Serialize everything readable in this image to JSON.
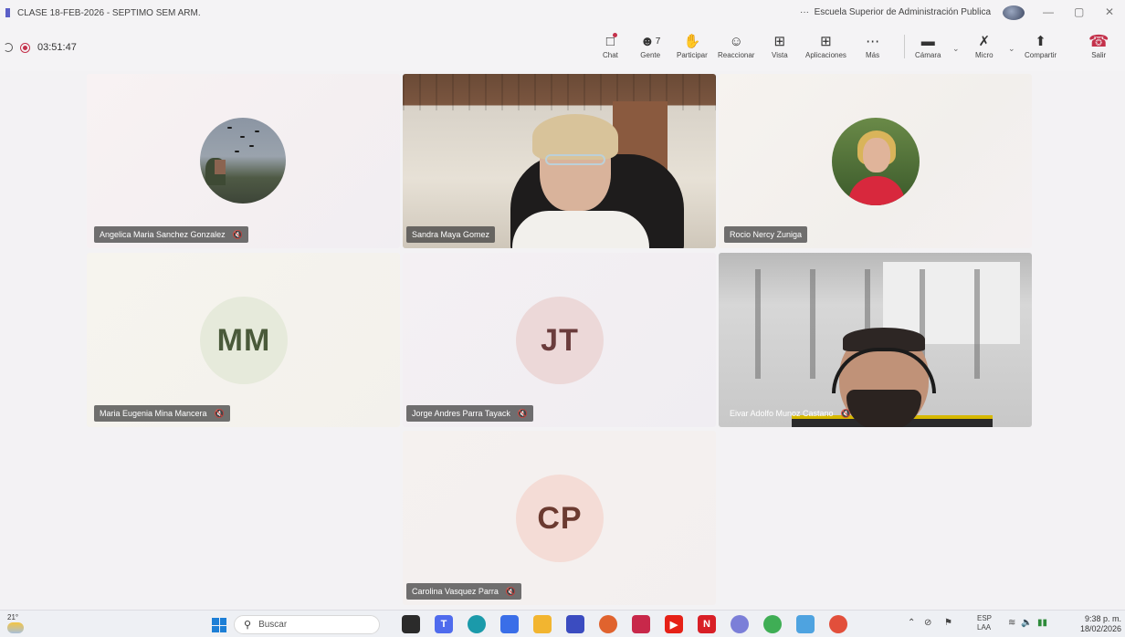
{
  "window": {
    "title": "CLASE 18-FEB-2026 - SEPTIMO SEM ARM.",
    "more": "···",
    "org_name": "Escuela Superior de Administración Publica",
    "minimize": "—",
    "restore": "▢",
    "close": "✕"
  },
  "meeting": {
    "elapsed": "03:51:47"
  },
  "toolbar": {
    "chat": "Chat",
    "people": "Gente",
    "people_count": "7",
    "raise": "Participar",
    "react": "Reaccionar",
    "view": "Vista",
    "apps": "Aplicaciones",
    "more": "Más",
    "camera": "Cámara",
    "mic": "Micro",
    "share": "Compartir",
    "leave": "Salir"
  },
  "participants": [
    {
      "name": "Angelica Maria Sanchez Gonzalez",
      "type": "photo"
    },
    {
      "name": "Sandra Maya Gomez",
      "type": "video"
    },
    {
      "name": "Rocio Nercy Zuniga",
      "type": "photo"
    },
    {
      "name": "Maria Eugenia Mina Mancera",
      "type": "initials",
      "initials": "MM",
      "bg": "#e6eadb",
      "fg": "#4a5a3a"
    },
    {
      "name": "Jorge Andres Parra Tayack",
      "type": "initials",
      "initials": "JT",
      "bg": "#ecd8d8",
      "fg": "#6a3c3c"
    },
    {
      "name": "Eivar Adolfo Munoz Castano",
      "type": "video"
    },
    {
      "name": "Carolina Vasquez Parra",
      "type": "initials",
      "initials": "CP",
      "bg": "#f4dcd6",
      "fg": "#6b3a30"
    }
  ],
  "taskbar": {
    "weather_temp": "21°",
    "search_placeholder": "Buscar",
    "lang_top": "ESP",
    "lang_bottom": "LAA",
    "time": "9:38 p. m.",
    "date": "18/02/2026"
  },
  "colors": {
    "accent": "#5b5fc7",
    "record": "#c4314b",
    "leave": "#c4314b"
  }
}
